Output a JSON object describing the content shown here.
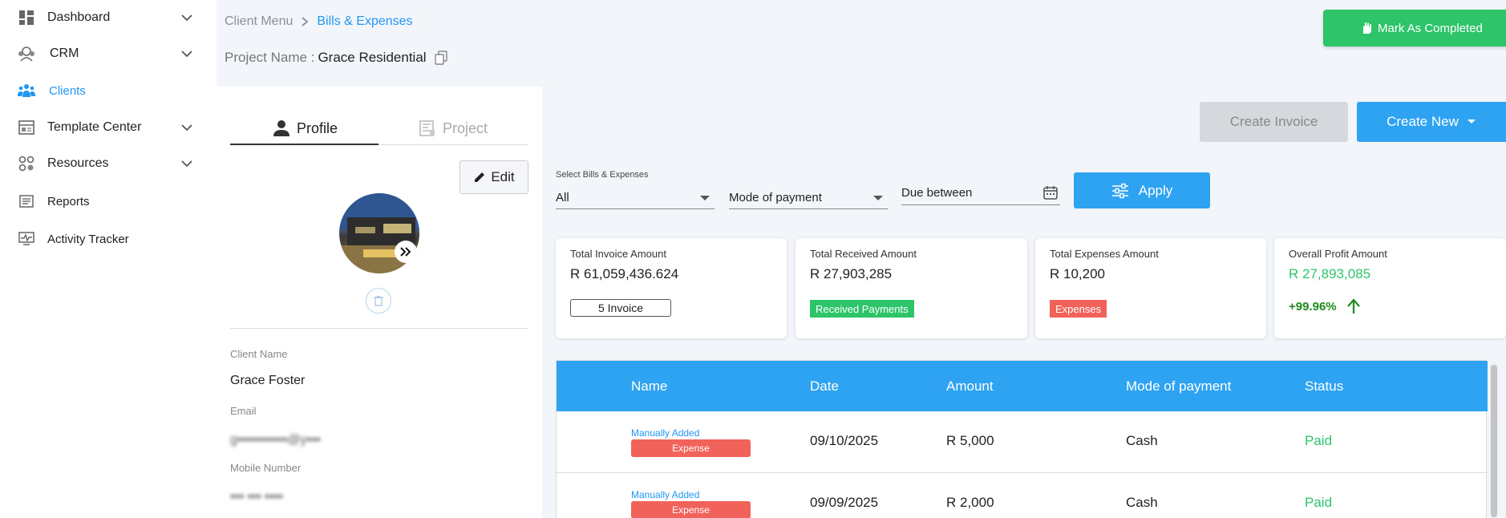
{
  "sidebar": {
    "items": [
      {
        "label": "Dashboard",
        "icon": "dashboard-icon",
        "expandable": true
      },
      {
        "label": "CRM",
        "icon": "crm-icon",
        "expandable": true
      },
      {
        "label": "Clients",
        "icon": "clients-icon",
        "expandable": false,
        "active": true
      },
      {
        "label": "Template Center",
        "icon": "template-icon",
        "expandable": true
      },
      {
        "label": "Resources",
        "icon": "resources-icon",
        "expandable": true
      },
      {
        "label": "Reports",
        "icon": "reports-icon",
        "expandable": false
      },
      {
        "label": "Activity Tracker",
        "icon": "activity-icon",
        "expandable": false
      }
    ]
  },
  "header": {
    "breadcrumb": [
      "Client Menu",
      "Bills & Expenses"
    ],
    "project_label": "Project Name :",
    "project_name": "Grace Residential",
    "mark_completed": "Mark As Completed"
  },
  "profile": {
    "tabs": [
      "Profile",
      "Project"
    ],
    "edit_label": "Edit",
    "fields": [
      {
        "label": "Client Name",
        "value": "Grace Foster"
      },
      {
        "label": "Email",
        "value": "g▪▪▪▪▪▪▪▪▪▪▪@y▪▪▪"
      },
      {
        "label": "Mobile Number",
        "value": "▪▪▪ ▪▪▪ ▪▪▪▪"
      }
    ]
  },
  "actions": {
    "create_invoice": "Create Invoice",
    "create_new": "Create New"
  },
  "filters": {
    "title": "Select Bills & Expenses",
    "bills_value": "All",
    "mode_placeholder": "Mode of payment",
    "due_placeholder": "Due between",
    "apply": "Apply"
  },
  "cards": [
    {
      "title": "Total Invoice Amount",
      "value": "R 61,059,436.624",
      "badge": "5 Invoice"
    },
    {
      "title": "Total Received Amount",
      "value": "R 27,903,285",
      "badge": "Received Payments"
    },
    {
      "title": "Total Expenses Amount",
      "value": "R 10,200",
      "badge": "Expenses"
    },
    {
      "title": "Overall Profit Amount",
      "value": "R 27,893,085",
      "badge": "+99.96%"
    }
  ],
  "colors": {
    "accent": "#2ea3f2",
    "success": "#2dc46a",
    "danger": "#f0625a",
    "profit_up": "#1f8a1f"
  },
  "table": {
    "columns": [
      "Name",
      "Date",
      "Amount",
      "Mode of payment",
      "Status"
    ],
    "rows": [
      {
        "source": "Manually Added",
        "type": "Expense",
        "date": "09/10/2025",
        "amount": "R 5,000",
        "mode": "Cash",
        "status": "Paid"
      },
      {
        "source": "Manually Added",
        "type": "Expense",
        "date": "09/09/2025",
        "amount": "R 2,000",
        "mode": "Cash",
        "status": "Paid"
      }
    ]
  }
}
